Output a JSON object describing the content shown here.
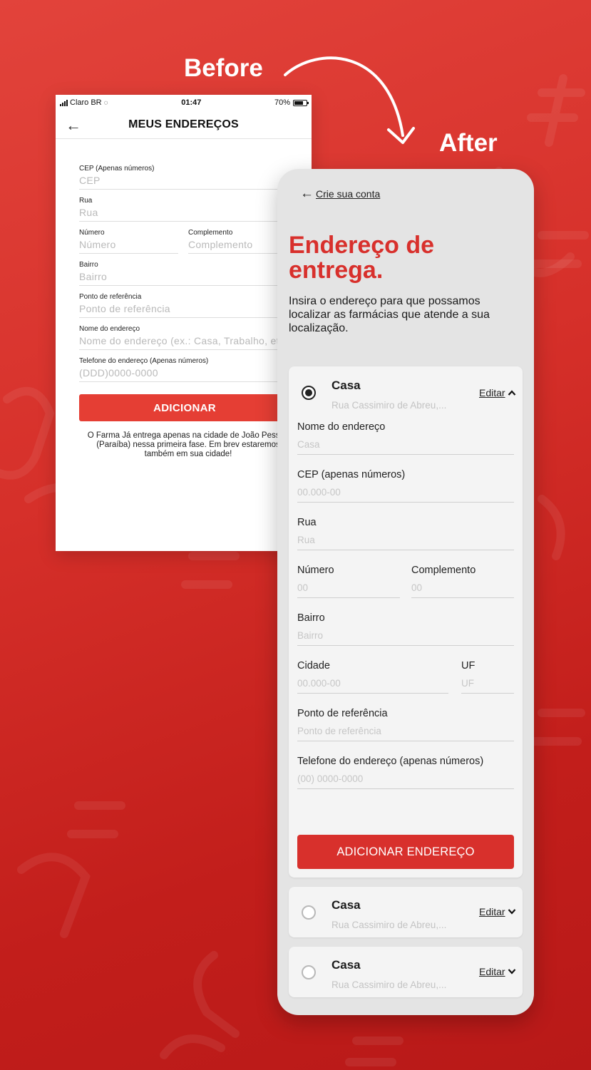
{
  "labels": {
    "before": "Before",
    "after": "After"
  },
  "colors": {
    "brand_red": "#d8302c",
    "background_red": "#c8221f",
    "placeholder": "#c6c6c6"
  },
  "before": {
    "status": {
      "carrier": "Claro BR",
      "time": "01:47",
      "battery": "70%"
    },
    "header_title": "MEUS ENDEREÇOS",
    "back_icon": "arrow-left-icon",
    "fields": [
      {
        "label": "CEP (Apenas números)",
        "placeholder": "CEP"
      },
      {
        "label": "Rua",
        "placeholder": "Rua"
      },
      {
        "label": "Número",
        "placeholder": "Número"
      },
      {
        "label": "Complemento",
        "placeholder": "Complemento"
      },
      {
        "label": "Bairro",
        "placeholder": "Bairro"
      },
      {
        "label": "Ponto de referência",
        "placeholder": "Ponto de referência"
      },
      {
        "label": "Nome do endereço",
        "placeholder": "Nome do endereço (ex.: Casa, Trabalho, etc"
      },
      {
        "label": "Telefone do endereço (Apenas números)",
        "placeholder": "(DDD)0000-0000"
      }
    ],
    "button": "ADICIONAR",
    "note": "O Farma Já entrega apenas na cidade de João Pessoa (Paraíba) nessa primeira fase. Em brev estaremos também em sua cidade!"
  },
  "after": {
    "back_label": "Crie sua conta",
    "title": "Endereço de entrega.",
    "subtitle": "Insira o endereço para que possamos localizar as farmácias que atende a sua localização.",
    "cards": [
      {
        "name": "Casa",
        "address": "Rua Cassimiro de Abreu,...",
        "edit": "Editar",
        "selected": true
      },
      {
        "name": "Casa",
        "address": "Rua Cassimiro de Abreu,...",
        "edit": "Editar",
        "selected": false
      },
      {
        "name": "Casa",
        "address": "Rua Cassimiro de Abreu,...",
        "edit": "Editar",
        "selected": false
      }
    ],
    "fields": {
      "nome": {
        "label": "Nome do endereço",
        "placeholder": "Casa"
      },
      "cep": {
        "label": "CEP (apenas números)",
        "placeholder": "00.000-00"
      },
      "rua": {
        "label": "Rua",
        "placeholder": "Rua"
      },
      "numero": {
        "label": "Número",
        "placeholder": "00"
      },
      "complemento": {
        "label": "Complemento",
        "placeholder": "00"
      },
      "bairro": {
        "label": "Bairro",
        "placeholder": "Bairro"
      },
      "cidade": {
        "label": "Cidade",
        "placeholder": "00.000-00"
      },
      "uf": {
        "label": "UF",
        "placeholder": "UF"
      },
      "referencia": {
        "label": "Ponto de referência",
        "placeholder": "Ponto de referência"
      },
      "telefone": {
        "label": "Telefone do endereço (apenas números)",
        "placeholder": "(00) 0000-0000"
      }
    },
    "button": "ADICIONAR ENDEREÇO"
  }
}
